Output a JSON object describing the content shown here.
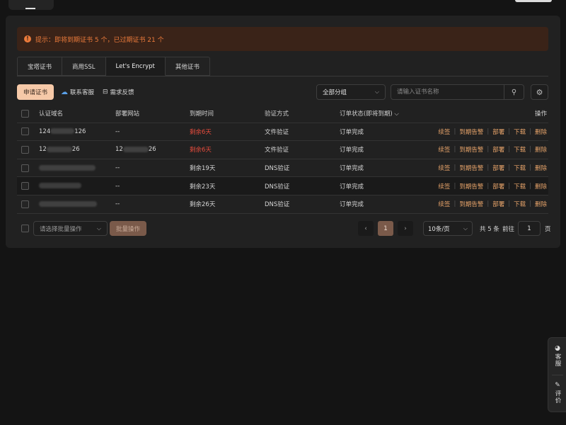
{
  "notice": {
    "text": "提示：即将到期证书 5 个，已过期证书 21 个"
  },
  "tabs": [
    {
      "label": "宝塔证书"
    },
    {
      "label": "商用SSL"
    },
    {
      "label": "Let's Encrypt"
    },
    {
      "label": "其他证书"
    }
  ],
  "toolbar": {
    "apply_label": "申请证书",
    "contact_label": "联系客服",
    "feedback_label": "需求反馈",
    "group_value": "全部分组",
    "search_placeholder": "请输入证书名称"
  },
  "table": {
    "headers": {
      "domain": "认证域名",
      "site": "部署网站",
      "expire": "到期时间",
      "verify": "验证方式",
      "status": "订单状态(即将到期)",
      "ops": "操作"
    },
    "rows": [
      {
        "domain_prefix": "124",
        "domain_suffix": "126",
        "site": "--",
        "site_prefix": "",
        "site_suffix": "",
        "expire": "剩余6天",
        "verify": "文件验证",
        "status": "订单完成"
      },
      {
        "domain_prefix": "12",
        "domain_suffix": "26",
        "site": "",
        "site_prefix": "12",
        "site_suffix": "26",
        "expire": "剩余6天",
        "verify": "文件验证",
        "status": "订单完成"
      },
      {
        "domain_prefix": "",
        "domain_suffix": "",
        "site": "--",
        "site_prefix": "",
        "site_suffix": "",
        "expire": "剩余19天",
        "verify": "DNS验证",
        "status": "订单完成"
      },
      {
        "domain_prefix": "",
        "domain_suffix": "",
        "site": "--",
        "site_prefix": "",
        "site_suffix": "",
        "expire": "剩余23天",
        "verify": "DNS验证",
        "status": "订单完成"
      },
      {
        "domain_prefix": "",
        "domain_suffix": "",
        "site": "--",
        "site_prefix": "",
        "site_suffix": "",
        "expire": "剩余26天",
        "verify": "DNS验证",
        "status": "订单完成"
      }
    ],
    "actions": [
      "续签",
      "到期告警",
      "部署",
      "下载",
      "删除"
    ]
  },
  "footer": {
    "batch_placeholder": "请选择批量操作",
    "batch_button": "批量操作",
    "current_page": "1",
    "page_size": "10条/页",
    "total": "共 5 条",
    "goto_label": "前往",
    "goto_value": "1",
    "page_unit": "页"
  },
  "float_panel": {
    "service_label": "客服",
    "review_label": "评价"
  },
  "colors": {
    "accent": "#f6c9a8",
    "warning": "#ec7b3b",
    "danger": "#e84c3d",
    "action": "#e8a46a"
  }
}
